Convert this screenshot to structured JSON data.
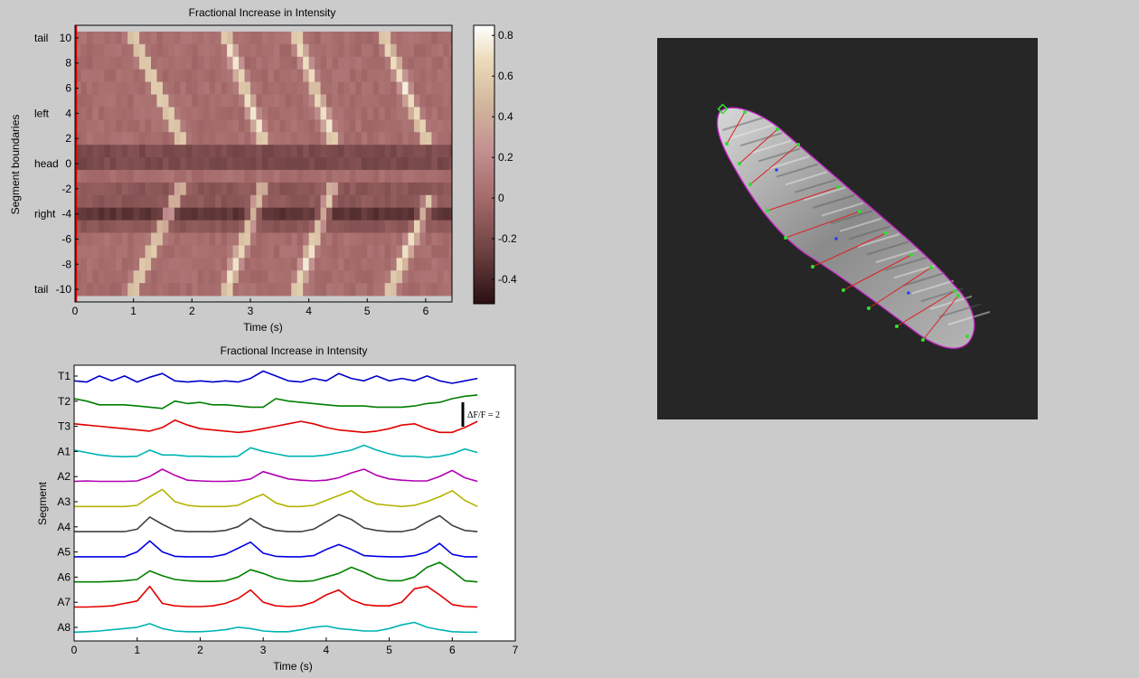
{
  "chart_data": [
    {
      "type": "heatmap",
      "title": "Fractional Increase in Intensity",
      "xlabel": "Time (s)",
      "ylabel": "Segment boundaries",
      "xlim": [
        0,
        6.45
      ],
      "ylim": [
        -11,
        11
      ],
      "xticks": [
        0,
        1,
        2,
        3,
        4,
        5,
        6
      ],
      "yticks": [
        10,
        8,
        6,
        4,
        2,
        0,
        -2,
        -4,
        -6,
        -8,
        -10
      ],
      "ytick_labels": [
        "10",
        "8",
        "6",
        "4",
        "2",
        "0",
        "-2",
        "-4",
        "-6",
        "-8",
        "-10"
      ],
      "side_labels": [
        {
          "at": 10,
          "text": "tail"
        },
        {
          "at": 4,
          "text": "left"
        },
        {
          "at": 0,
          "text": "head"
        },
        {
          "at": -4,
          "text": "right"
        },
        {
          "at": -10,
          "text": "tail"
        }
      ],
      "colorbar": {
        "min": -0.52,
        "max": 0.85,
        "ticks": [
          0.8,
          0.6,
          0.4,
          0.2,
          0,
          -0.2,
          -0.4
        ],
        "tick_labels": [
          "0.8",
          "0.6",
          "0.4",
          "0.2",
          "0",
          "-0.2",
          "-0.4"
        ]
      },
      "wave_paths": [
        {
          "row_from": 10,
          "row_to": 2,
          "t_from": 0.95,
          "t_to": 1.75
        },
        {
          "row_from": 10,
          "row_to": 2,
          "t_from": 2.55,
          "t_to": 3.15
        },
        {
          "row_from": 10,
          "row_to": 2,
          "t_from": 3.75,
          "t_to": 4.35
        },
        {
          "row_from": 10,
          "row_to": 2,
          "t_from": 5.25,
          "t_to": 5.95
        },
        {
          "row_from": -10,
          "row_to": -2,
          "t_from": 0.95,
          "t_to": 1.75
        },
        {
          "row_from": -10,
          "row_to": -2,
          "t_from": 2.55,
          "t_to": 3.15
        },
        {
          "row_from": -10,
          "row_to": -2,
          "t_from": 3.75,
          "t_to": 4.35
        },
        {
          "row_from": -10,
          "row_to": -3,
          "t_from": 5.35,
          "t_to": 6.0
        }
      ]
    },
    {
      "type": "line",
      "title": "Fractional Increase in Intensity",
      "xlabel": "Time (s)",
      "ylabel": "Segment",
      "xlim": [
        0,
        7
      ],
      "xticks": [
        0,
        1,
        2,
        3,
        4,
        5,
        6,
        7
      ],
      "scale_bar_label": "ΔF/F = 2",
      "x": [
        0,
        0.2,
        0.4,
        0.6,
        0.8,
        1.0,
        1.2,
        1.4,
        1.6,
        1.8,
        2.0,
        2.2,
        2.4,
        2.6,
        2.8,
        3.0,
        3.2,
        3.4,
        3.6,
        3.8,
        4.0,
        4.2,
        4.4,
        4.6,
        4.8,
        5.0,
        5.2,
        5.4,
        5.6,
        5.8,
        6.0,
        6.2,
        6.4
      ],
      "series": [
        {
          "name": "T1",
          "color": "#0000cc",
          "values": [
            0.1,
            0.05,
            0.3,
            0.1,
            0.3,
            0.05,
            0.25,
            0.4,
            0.1,
            0.05,
            0.1,
            0.05,
            0.1,
            0.05,
            0.2,
            0.5,
            0.3,
            0.1,
            0.05,
            0.2,
            0.1,
            0.4,
            0.2,
            0.1,
            0.3,
            0.1,
            0.2,
            0.1,
            0.3,
            0.1,
            0.0,
            0.1,
            0.2
          ]
        },
        {
          "name": "T2",
          "color": "#007f00",
          "values": [
            0.4,
            0.3,
            0.15,
            0.15,
            0.15,
            0.1,
            0.05,
            0.0,
            0.3,
            0.2,
            0.25,
            0.15,
            0.15,
            0.1,
            0.05,
            0.05,
            0.4,
            0.3,
            0.25,
            0.2,
            0.15,
            0.1,
            0.1,
            0.1,
            0.05,
            0.05,
            0.05,
            0.1,
            0.2,
            0.25,
            0.4,
            0.5,
            0.55
          ]
        },
        {
          "name": "T3",
          "color": "#e00000",
          "values": [
            0.4,
            0.35,
            0.3,
            0.25,
            0.2,
            0.15,
            0.1,
            0.25,
            0.55,
            0.35,
            0.2,
            0.15,
            0.1,
            0.05,
            0.1,
            0.2,
            0.3,
            0.4,
            0.5,
            0.4,
            0.25,
            0.15,
            0.1,
            0.05,
            0.1,
            0.2,
            0.35,
            0.4,
            0.2,
            0.05,
            0.05,
            0.25,
            0.5
          ]
        },
        {
          "name": "A1",
          "color": "#00b3b3",
          "values": [
            0.35,
            0.25,
            0.15,
            0.1,
            0.08,
            0.1,
            0.35,
            0.15,
            0.15,
            0.1,
            0.1,
            0.08,
            0.08,
            0.1,
            0.45,
            0.3,
            0.2,
            0.1,
            0.1,
            0.1,
            0.15,
            0.25,
            0.35,
            0.55,
            0.35,
            0.2,
            0.1,
            0.1,
            0.05,
            0.1,
            0.2,
            0.4,
            0.25
          ]
        },
        {
          "name": "A2",
          "color": "#b300b3",
          "values": [
            0.1,
            0.12,
            0.1,
            0.1,
            0.1,
            0.12,
            0.3,
            0.6,
            0.35,
            0.15,
            0.12,
            0.1,
            0.1,
            0.12,
            0.2,
            0.5,
            0.35,
            0.2,
            0.15,
            0.12,
            0.15,
            0.25,
            0.45,
            0.6,
            0.35,
            0.2,
            0.15,
            0.12,
            0.12,
            0.3,
            0.55,
            0.25,
            0.1
          ]
        },
        {
          "name": "A3",
          "color": "#b3b300",
          "values": [
            0.1,
            0.1,
            0.1,
            0.1,
            0.1,
            0.15,
            0.5,
            0.8,
            0.3,
            0.15,
            0.1,
            0.1,
            0.1,
            0.15,
            0.4,
            0.6,
            0.25,
            0.1,
            0.1,
            0.15,
            0.35,
            0.55,
            0.75,
            0.4,
            0.2,
            0.15,
            0.1,
            0.15,
            0.3,
            0.5,
            0.75,
            0.35,
            0.1
          ]
        },
        {
          "name": "A4",
          "color": "#404040",
          "values": [
            0.1,
            0.1,
            0.1,
            0.1,
            0.1,
            0.2,
            0.7,
            0.4,
            0.15,
            0.1,
            0.1,
            0.1,
            0.15,
            0.3,
            0.65,
            0.3,
            0.15,
            0.1,
            0.1,
            0.2,
            0.5,
            0.8,
            0.6,
            0.25,
            0.15,
            0.1,
            0.1,
            0.2,
            0.5,
            0.75,
            0.35,
            0.15,
            0.1
          ]
        },
        {
          "name": "A5",
          "color": "#0000e6",
          "values": [
            0.1,
            0.1,
            0.1,
            0.1,
            0.1,
            0.3,
            0.75,
            0.3,
            0.12,
            0.1,
            0.1,
            0.1,
            0.2,
            0.45,
            0.7,
            0.25,
            0.12,
            0.1,
            0.1,
            0.15,
            0.4,
            0.6,
            0.4,
            0.15,
            0.12,
            0.1,
            0.1,
            0.15,
            0.3,
            0.65,
            0.2,
            0.1,
            0.1
          ]
        },
        {
          "name": "A6",
          "color": "#008000",
          "values": [
            0.1,
            0.1,
            0.1,
            0.12,
            0.15,
            0.2,
            0.55,
            0.35,
            0.2,
            0.15,
            0.12,
            0.12,
            0.15,
            0.3,
            0.6,
            0.45,
            0.25,
            0.15,
            0.12,
            0.15,
            0.3,
            0.45,
            0.7,
            0.5,
            0.25,
            0.15,
            0.15,
            0.3,
            0.7,
            0.9,
            0.55,
            0.15,
            0.1
          ]
        },
        {
          "name": "A7",
          "color": "#e00000",
          "values": [
            0.1,
            0.1,
            0.12,
            0.15,
            0.25,
            0.35,
            0.95,
            0.25,
            0.15,
            0.12,
            0.12,
            0.15,
            0.25,
            0.45,
            0.8,
            0.3,
            0.15,
            0.12,
            0.15,
            0.3,
            0.6,
            0.8,
            0.4,
            0.2,
            0.15,
            0.15,
            0.3,
            0.85,
            0.95,
            0.6,
            0.2,
            0.12,
            0.1
          ]
        },
        {
          "name": "A8",
          "color": "#00b3b3",
          "values": [
            0.1,
            0.12,
            0.15,
            0.2,
            0.25,
            0.3,
            0.45,
            0.25,
            0.15,
            0.12,
            0.12,
            0.15,
            0.2,
            0.3,
            0.25,
            0.15,
            0.12,
            0.12,
            0.2,
            0.3,
            0.35,
            0.25,
            0.2,
            0.15,
            0.15,
            0.25,
            0.4,
            0.5,
            0.3,
            0.2,
            0.12,
            0.1,
            0.1
          ]
        }
      ]
    }
  ],
  "image_panel": {
    "background": "#262626",
    "outline_color": "#cc22cc",
    "segment_line_color": "#dd2222",
    "marker_color": "#33dd33",
    "center_marker_color": "#2233ff"
  }
}
